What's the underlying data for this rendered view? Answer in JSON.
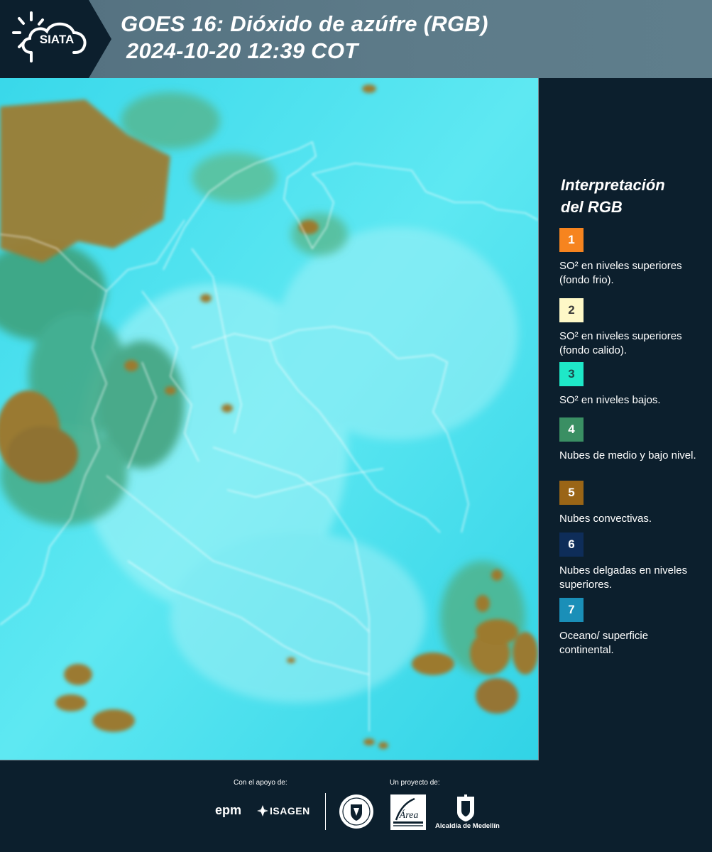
{
  "header": {
    "logo_text": "SIATA",
    "title_line1": "GOES 16: Dióxido de azúfre (RGB)",
    "title_line2": "2024-10-20 12:39 COT"
  },
  "map": {
    "icon": "satellite-map",
    "colors": {
      "background": "#2fd8e8",
      "cloud_convective": "#9a7a2e",
      "low_clouds": "#3aa46a",
      "boundaries": "#ffffff"
    }
  },
  "legend": {
    "title_line1": "Interpretación",
    "title_line2": "del RGB",
    "items": [
      {
        "number": "1",
        "text": "SO² en niveles superiores (fondo frio).",
        "color": "#f6841f",
        "number_color": "#ffffff"
      },
      {
        "number": "2",
        "text": "SO² en niveles superiores (fondo calido).",
        "color": "#fef8c7",
        "number_color": "#3a3a3a"
      },
      {
        "number": "3",
        "text": "SO² en niveles bajos.",
        "color": "#1ee8c8",
        "number_color": "#1b4a4a"
      },
      {
        "number": "4",
        "text": "Nubes de medio y bajo nivel.",
        "color": "#3a8f63",
        "number_color": "#ffffff"
      },
      {
        "number": "5",
        "text": "Nubes convectivas.",
        "color": "#9a6516",
        "number_color": "#ffffff"
      },
      {
        "number": "6",
        "text": "Nubes delgadas en niveles superiores.",
        "color": "#0e2d59",
        "number_color": "#ffffff"
      },
      {
        "number": "7",
        "text": "Oceano/ superficie continental.",
        "color": "#1a8fb8",
        "number_color": "#ffffff"
      }
    ]
  },
  "footer": {
    "support_label": "Con el apoyo de:",
    "project_label": "Un proyecto de:",
    "logo_epm": "epm",
    "logo_isagen": "ISAGEN",
    "logo_area_metro": "Área",
    "logo_alcaldia": "Alcaldía de Medellín"
  }
}
